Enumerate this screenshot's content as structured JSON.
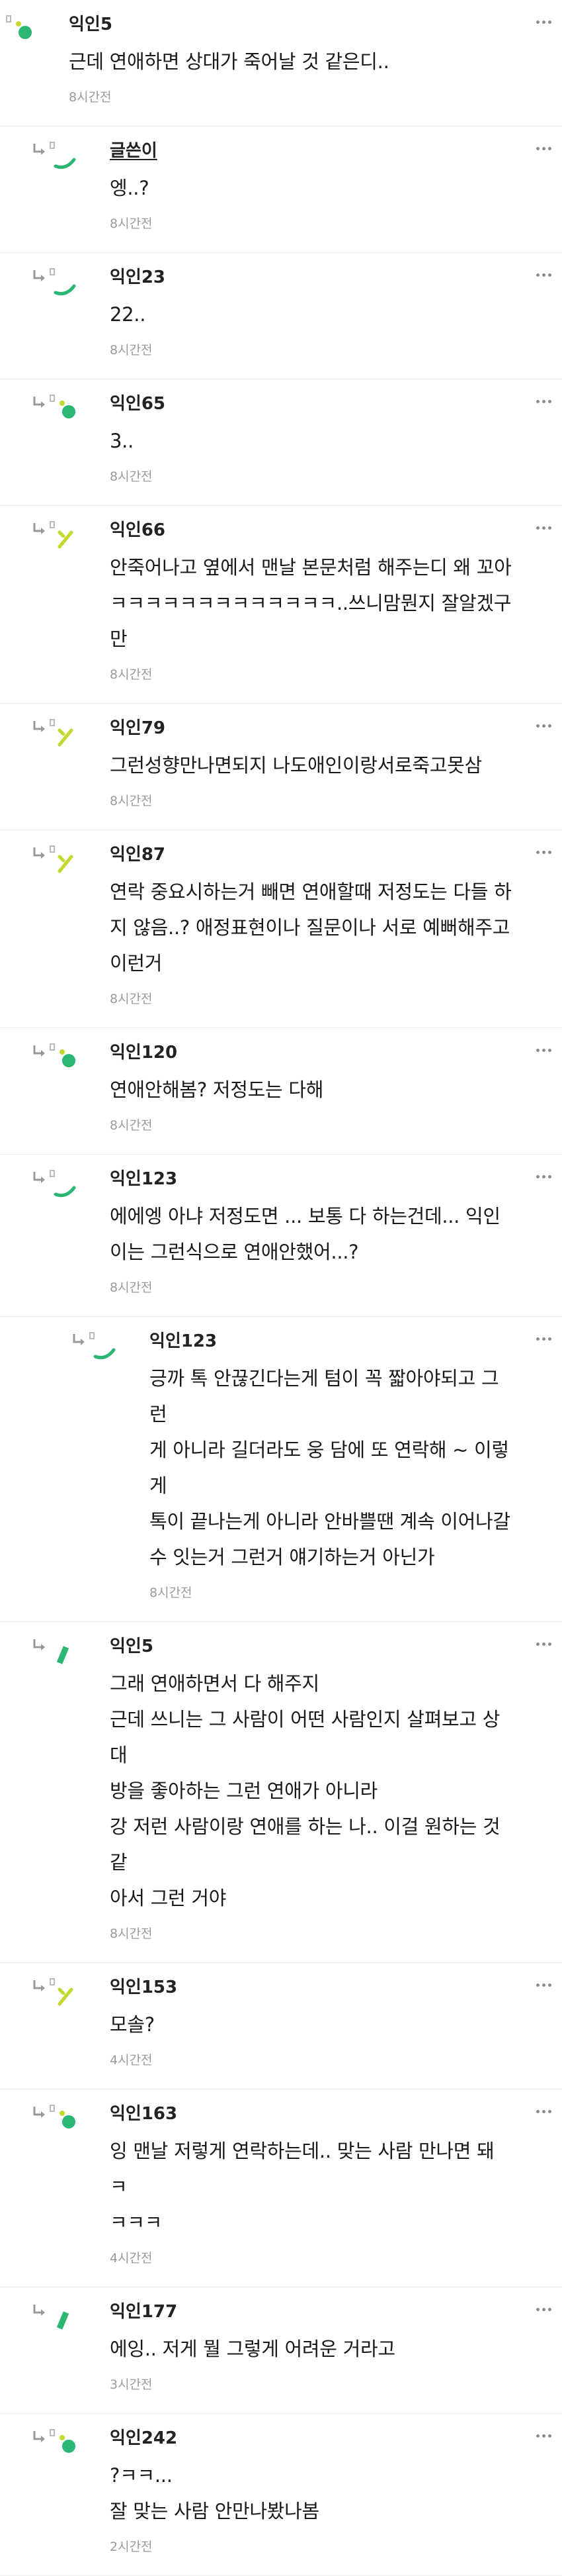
{
  "comments": [
    {
      "author": "익인5",
      "text": "근데 연애하면 상대가 죽어날 것 같은디..",
      "time": "8시간전",
      "level": 0,
      "reply": false,
      "op": false,
      "avatar": "dots"
    },
    {
      "author": "글쓴이",
      "text": "엥..?",
      "time": "8시간전",
      "level": 1,
      "reply": true,
      "op": true,
      "avatar": "arc-green"
    },
    {
      "author": "익인23",
      "text": "22..",
      "time": "8시간전",
      "level": 1,
      "reply": true,
      "op": false,
      "avatar": "arc-green"
    },
    {
      "author": "익인65",
      "text": "3..",
      "time": "8시간전",
      "level": 1,
      "reply": true,
      "op": false,
      "avatar": "dots"
    },
    {
      "author": "익인66",
      "text": "안죽어나고 옆에서 맨날 본문처럼 해주는디 왜 꼬아\nㅋㅋㅋㅋㅋㅋㅋㅋㅋㅋㅋㅋㅋ..쓰니맘뭔지 잘알겠구만",
      "time": "8시간전",
      "level": 1,
      "reply": true,
      "op": false,
      "avatar": "check-lime"
    },
    {
      "author": "익인79",
      "text": "그런성향만나면되지 나도애인이랑서로죽고못삼",
      "time": "8시간전",
      "level": 1,
      "reply": true,
      "op": false,
      "avatar": "check-lime"
    },
    {
      "author": "익인87",
      "text": "연락 중요시하는거 빼면 연애할때 저정도는 다들 하\n지 않음..? 애정표현이나 질문이나 서로 예뻐해주고\n이런거",
      "time": "8시간전",
      "level": 1,
      "reply": true,
      "op": false,
      "avatar": "check-lime"
    },
    {
      "author": "익인120",
      "text": "연애안해봄? 저정도는 다해",
      "time": "8시간전",
      "level": 1,
      "reply": true,
      "op": false,
      "avatar": "dots"
    },
    {
      "author": "익인123",
      "text": "에에엥 아냐 저정도면 ... 보통 다 하는건데... 익인\n이는 그런식으로 연애안했어...?",
      "time": "8시간전",
      "level": 1,
      "reply": true,
      "op": false,
      "avatar": "arc-green"
    },
    {
      "author": "익인123",
      "text": "긍까 톡 안끊긴다는게 텀이 꼭 짧아야되고 그런\n게 아니라 길더라도 웅 담에 또 연락해 ~ 이렇게\n톡이 끝나는게 아니라 안바쁠땐 계속 이어나갈\n수 잇는거 그런거 얘기하는거 아닌가",
      "time": "8시간전",
      "level": 2,
      "reply": true,
      "op": false,
      "avatar": "arc-green"
    },
    {
      "author": "익인5",
      "text": "그래 연애하면서 다 해주지\n근데 쓰니는 그 사람이 어떤 사람인지 살펴보고 상대\n방을 좋아하는 그런 연애가 아니라\n강 저런 사람이랑 연애를 하는 나.. 이걸 원하는 것 같\n아서 그런 거야",
      "time": "8시간전",
      "level": 1,
      "reply": true,
      "op": false,
      "avatar": "slash-green"
    },
    {
      "author": "익인153",
      "text": "모솔?",
      "time": "4시간전",
      "level": 1,
      "reply": true,
      "op": false,
      "avatar": "check-lime"
    },
    {
      "author": "익인163",
      "text": "잉 맨날 저렇게 연락하는데.. 맞는 사람 만나면 돼 ㅋ\nㅋㅋㅋ",
      "time": "4시간전",
      "level": 1,
      "reply": true,
      "op": false,
      "avatar": "dots"
    },
    {
      "author": "익인177",
      "text": "에잉.. 저게 뭘 그렇게 어려운 거라고",
      "time": "3시간전",
      "level": 1,
      "reply": true,
      "op": false,
      "avatar": "slash-green"
    },
    {
      "author": "익인242",
      "text": "?ㅋㅋ...\n잘 맞는 사람 안만나봤나봄",
      "time": "2시간전",
      "level": 1,
      "reply": true,
      "op": false,
      "avatar": "dots"
    }
  ],
  "colors": {
    "green": "#2bb673",
    "lime": "#c5d82e",
    "grey": "#bbbbbb",
    "border": "#eeeeee",
    "time": "#9a9a9a"
  }
}
